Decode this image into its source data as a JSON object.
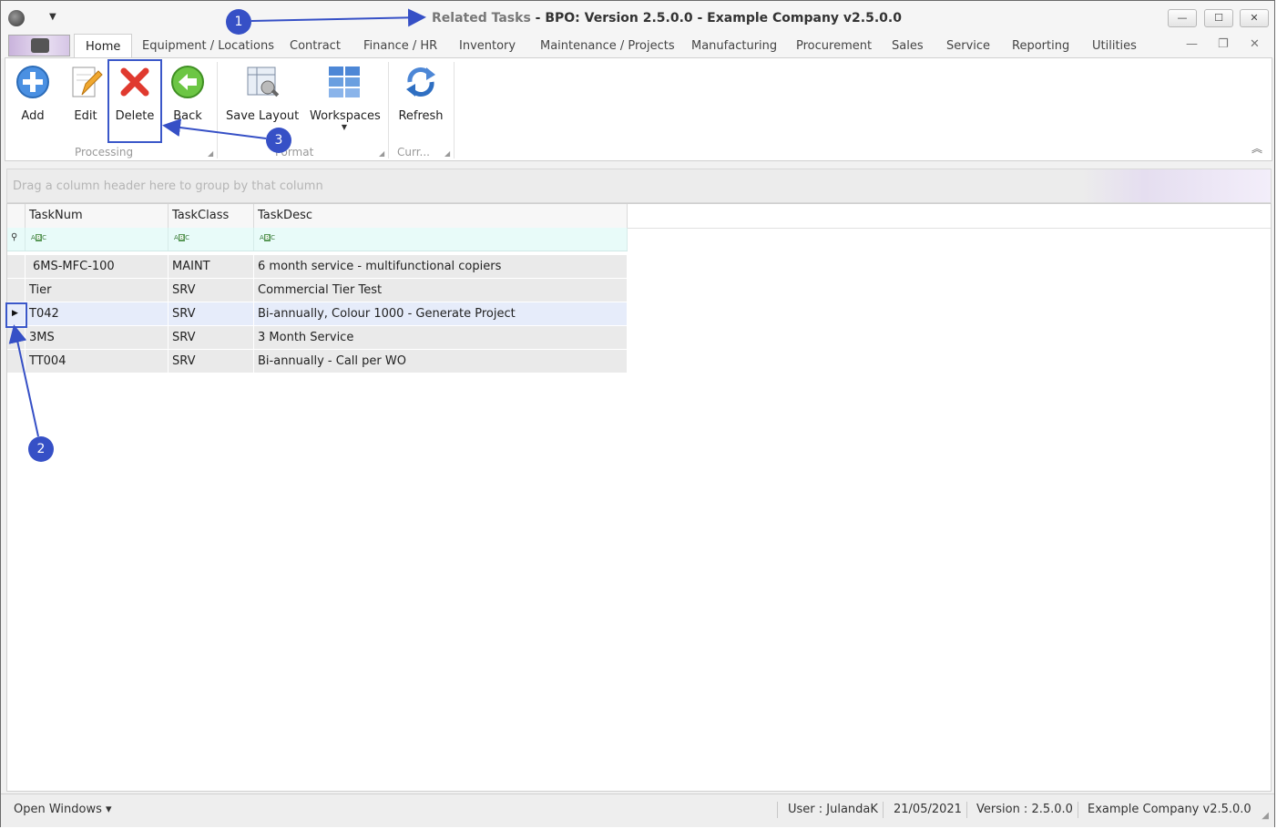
{
  "window": {
    "title_doc": "Related Tasks",
    "title_rest": " - BPO: Version 2.5.0.0 - Example Company v2.5.0.0",
    "minimize": "—",
    "maximize": "☐",
    "close": "✕"
  },
  "tabs": [
    {
      "label": "Home",
      "active": true
    },
    {
      "label": "Equipment / Locations"
    },
    {
      "label": "Contract"
    },
    {
      "label": "Finance / HR"
    },
    {
      "label": "Inventory"
    },
    {
      "label": "Maintenance / Projects"
    },
    {
      "label": "Manufacturing"
    },
    {
      "label": "Procurement"
    },
    {
      "label": "Sales"
    },
    {
      "label": "Service"
    },
    {
      "label": "Reporting"
    },
    {
      "label": "Utilities"
    }
  ],
  "ribbon": {
    "add": "Add",
    "edit": "Edit",
    "delete": "Delete",
    "back": "Back",
    "save_layout": "Save Layout",
    "workspaces": "Workspaces",
    "refresh": "Refresh",
    "group_processing": "Processing",
    "group_format": "Format",
    "group_current": "Curr..."
  },
  "grid": {
    "group_panel_hint": "Drag a column header here to group by that column",
    "columns": [
      "TaskNum",
      "TaskClass",
      "TaskDesc"
    ],
    "rows": [
      {
        "tasknum": "6MS-MFC-100",
        "taskclass": "MAINT",
        "taskdesc": "6 month service - multifunctional copiers"
      },
      {
        "tasknum": "Tier",
        "taskclass": "SRV",
        "taskdesc": "Commercial Tier Test"
      },
      {
        "tasknum": "T042",
        "taskclass": "SRV",
        "taskdesc": "Bi-annually, Colour 1000 - Generate Project",
        "selected": true
      },
      {
        "tasknum": "3MS",
        "taskclass": "SRV",
        "taskdesc": "3 Month Service"
      },
      {
        "tasknum": "TT004",
        "taskclass": "SRV",
        "taskdesc": "Bi-annually - Call per WO"
      }
    ]
  },
  "statusbar": {
    "open_windows": "Open Windows ▾",
    "user": "User : JulandaK",
    "date": "21/05/2021",
    "version": "Version : 2.5.0.0",
    "company": "Example Company v2.5.0.0"
  },
  "callouts": [
    "1",
    "2",
    "3"
  ],
  "colors": {
    "accent": "#3650c6",
    "selected_row": "#e6ecfa",
    "filter_row": "#e8fbf9"
  }
}
